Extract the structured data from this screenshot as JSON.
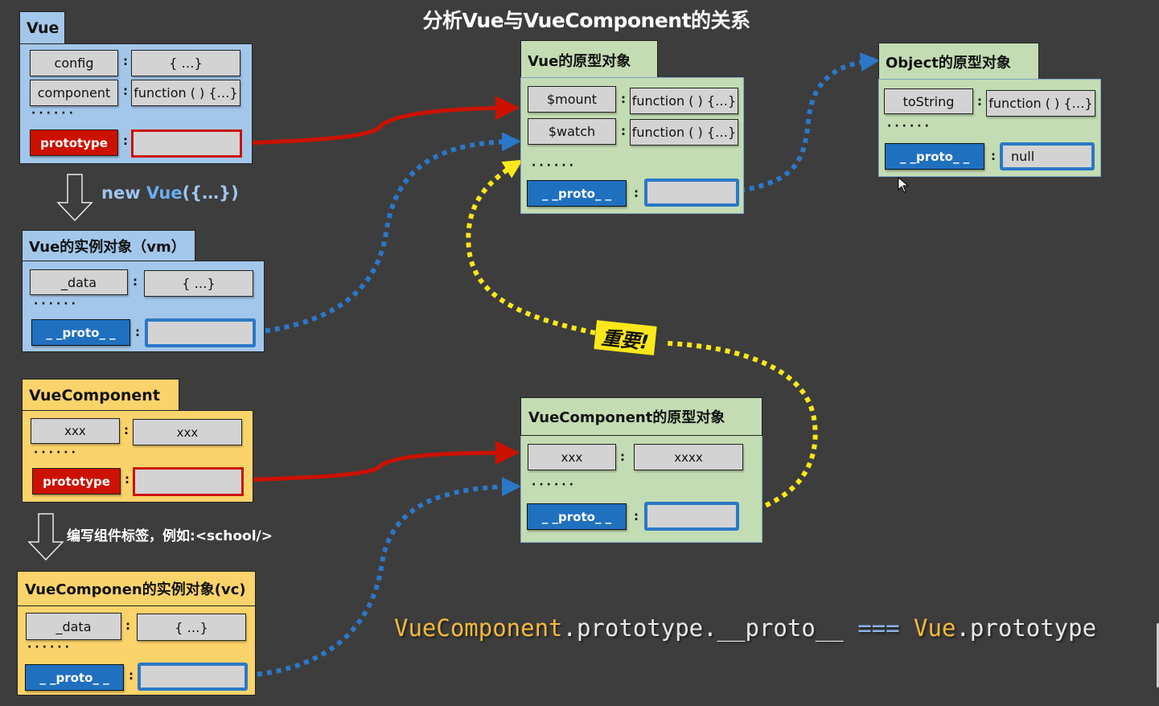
{
  "title": "分析Vue与VueComponent的关系",
  "vue": {
    "label": "Vue",
    "rows": [
      {
        "key": "config",
        "value": "{ …}"
      },
      {
        "key": "component",
        "value": "function ( ) {…}"
      }
    ],
    "ellipsis": "······",
    "prototype_key": "prototype",
    "prototype_value": ""
  },
  "new_vue": {
    "prefix": "new ",
    "vue": "Vue",
    "suffix": "({…})"
  },
  "vm": {
    "label": "Vue的实例对象（vm）",
    "rows": [
      {
        "key": "_data",
        "value": "{ …}"
      }
    ],
    "ellipsis": "······",
    "proto_key": "_ _proto_ _",
    "proto_value": ""
  },
  "vue_component": {
    "label": "VueComponent",
    "rows": [
      {
        "key": "xxx",
        "value": "xxx"
      }
    ],
    "ellipsis": "······",
    "prototype_key": "prototype",
    "prototype_value": ""
  },
  "write_tag_note": "编写组件标签，例如:<school/>",
  "vc": {
    "label": "VueComponen的实例对象(vc)",
    "rows": [
      {
        "key": "_data",
        "value": "{ …}"
      }
    ],
    "ellipsis": "······",
    "proto_key": "_ _proto_ _",
    "proto_value": ""
  },
  "vue_proto": {
    "label": "Vue的原型对象",
    "rows": [
      {
        "key": "$mount",
        "value": "function ( ) {…}"
      },
      {
        "key": "$watch",
        "value": "function ( ) {…}"
      }
    ],
    "ellipsis": "······",
    "proto_key": "_ _proto_ _",
    "proto_value": ""
  },
  "object_proto": {
    "label": "Object的原型对象",
    "rows": [
      {
        "key": "toString",
        "value": "function ( ) {…}"
      }
    ],
    "ellipsis": "······",
    "proto_key": "_ _proto_ _",
    "proto_value": "null"
  },
  "vc_proto": {
    "label": "VueComponent的原型对象",
    "rows": [
      {
        "key": "xxx",
        "value": "xxxx"
      }
    ],
    "ellipsis": "······",
    "proto_key": "_ _proto_ _",
    "proto_value": ""
  },
  "important_badge": "重要!",
  "colon": ":",
  "formula": {
    "part1": "VueComponent",
    "part2": ".prototype.__proto__",
    "op": "===",
    "part3": "Vue",
    "part4": ".prototype"
  },
  "colors": {
    "background": "#3d3d3d",
    "vue_blue": "#a3c7ea",
    "component_yellow": "#fbd36b",
    "prototype_green": "#c3dcb3",
    "prototype_link_red": "#cc1100",
    "proto_link_blue": "#2b78c8",
    "important_link_yellow": "#ffe81a"
  }
}
